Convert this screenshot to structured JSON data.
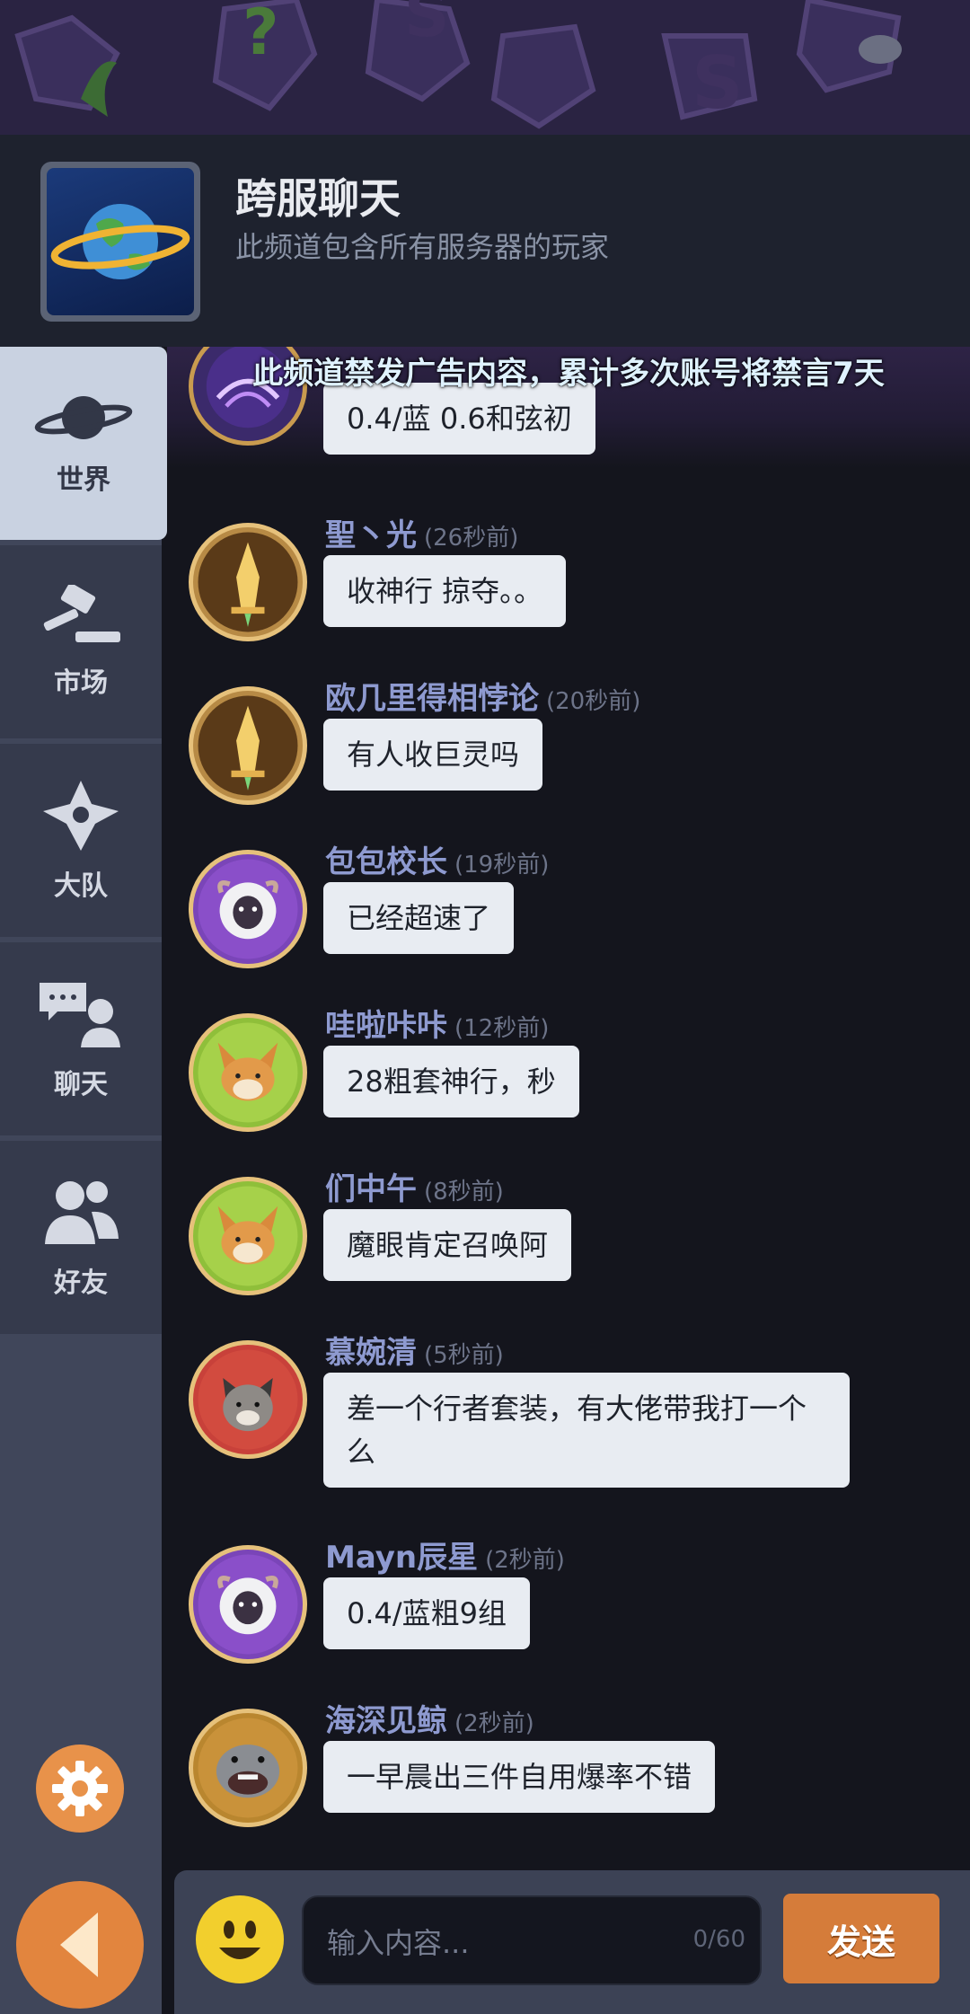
{
  "channel": {
    "title": "跨服聊天",
    "subtitle": "此频道包含所有服务器的玩家",
    "icon": "planet-icon"
  },
  "notice": "此频道禁发广告内容，累计多次账号将禁言7天",
  "sidebar": {
    "items": [
      {
        "label": "世界",
        "icon": "planet-icon",
        "active": true
      },
      {
        "label": "市场",
        "icon": "gavel-icon",
        "active": false
      },
      {
        "label": "大队",
        "icon": "team-icon",
        "active": false
      },
      {
        "label": "聊天",
        "icon": "chat-icon",
        "active": false
      },
      {
        "label": "好友",
        "icon": "friends-icon",
        "active": false
      }
    ],
    "settings_icon": "gear-icon",
    "back_icon": "back-arrow-icon"
  },
  "messages": [
    {
      "name": "",
      "time": "",
      "text": "0.4/蓝 0.6和弦初",
      "avatar": "vortex-avatar"
    },
    {
      "name": "聖丶光",
      "time": "(26秒前)",
      "text": "收神行 掠夺。。",
      "avatar": "sword-avatar"
    },
    {
      "name": "欧几里得相悖论",
      "time": "(20秒前)",
      "text": "有人收巨灵吗",
      "avatar": "sword-avatar"
    },
    {
      "name": "包包校长",
      "time": "(19秒前)",
      "text": "已经超速了",
      "avatar": "sheep-avatar"
    },
    {
      "name": "哇啦咔咔",
      "time": "(12秒前)",
      "text": "28粗套神行，秒",
      "avatar": "fox-avatar"
    },
    {
      "name": "们中午",
      "time": "(8秒前)",
      "text": "魔眼肯定召唤阿",
      "avatar": "fox-avatar"
    },
    {
      "name": "慕婉清",
      "time": "(5秒前)",
      "text": "差一个行者套装，有大佬带我打一个么",
      "avatar": "cat-avatar"
    },
    {
      "name": "Mayn辰星",
      "time": "(2秒前)",
      "text": "0.4/蓝粗9组",
      "avatar": "sheep-avatar"
    },
    {
      "name": "海深见鲸",
      "time": "(2秒前)",
      "text": "一早晨出三件自用爆率不错",
      "avatar": "hippo-avatar"
    }
  ],
  "input": {
    "placeholder": "输入内容...",
    "counter": "0/60",
    "emoji_icon": "smiley-icon",
    "send_label": "发送"
  },
  "colors": {
    "accent": "#d57c3a",
    "name": "#8e9ad0",
    "bubble": "#e8ecf2"
  }
}
